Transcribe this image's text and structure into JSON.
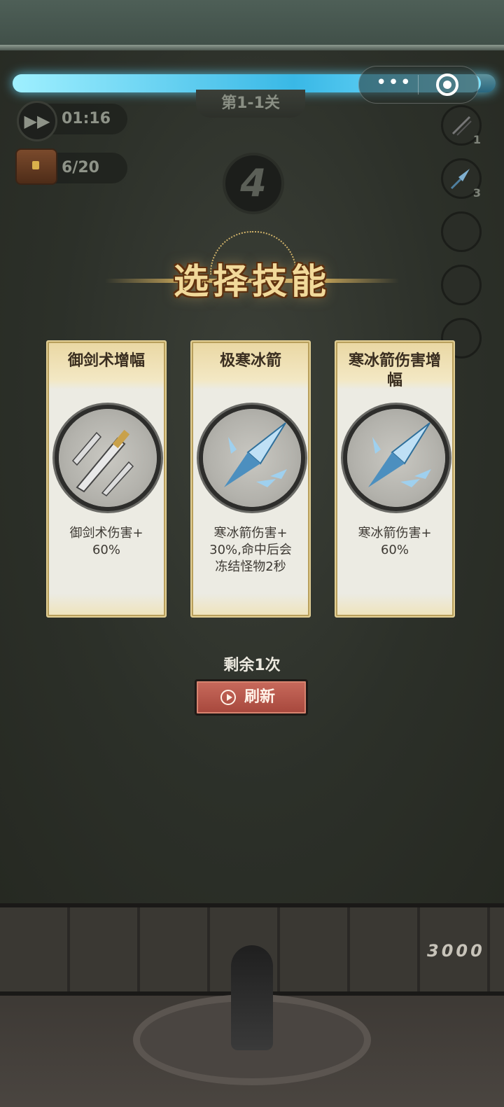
{
  "hud": {
    "stage": "第1-1关",
    "timer": "01:16",
    "chest_count": "6/20",
    "countdown": "4",
    "progress": 0.97,
    "capsule_dots": "•••"
  },
  "skill_slots": [
    {
      "level": "1",
      "icon": "swords-icon"
    },
    {
      "level": "3",
      "icon": "ice-arrow-icon"
    },
    {
      "level": "",
      "icon": "empty-slot"
    },
    {
      "level": "",
      "icon": "empty-slot"
    },
    {
      "level": "",
      "icon": "empty-slot"
    }
  ],
  "dialog": {
    "title": "选择技能",
    "cards": [
      {
        "name": "御剑术增幅",
        "description": "御剑术伤害+\n60%",
        "icon": "flying-swords-icon"
      },
      {
        "name": "极寒冰箭",
        "description": "寒冰箭伤害+\n30%,命中后会\n冻结怪物2秒",
        "icon": "ice-arrow-icon"
      },
      {
        "name": "寒冰箭伤害增幅",
        "description": "寒冰箭伤害+\n60%",
        "icon": "ice-arrow-icon"
      }
    ],
    "remaining": "剩余1次",
    "refresh_label": "刷新"
  },
  "bottom": {
    "score": "3000"
  },
  "colors": {
    "card_border": "#e2cf95",
    "refresh_button": "#b9584b",
    "progress_glow": "#39b8e6"
  }
}
